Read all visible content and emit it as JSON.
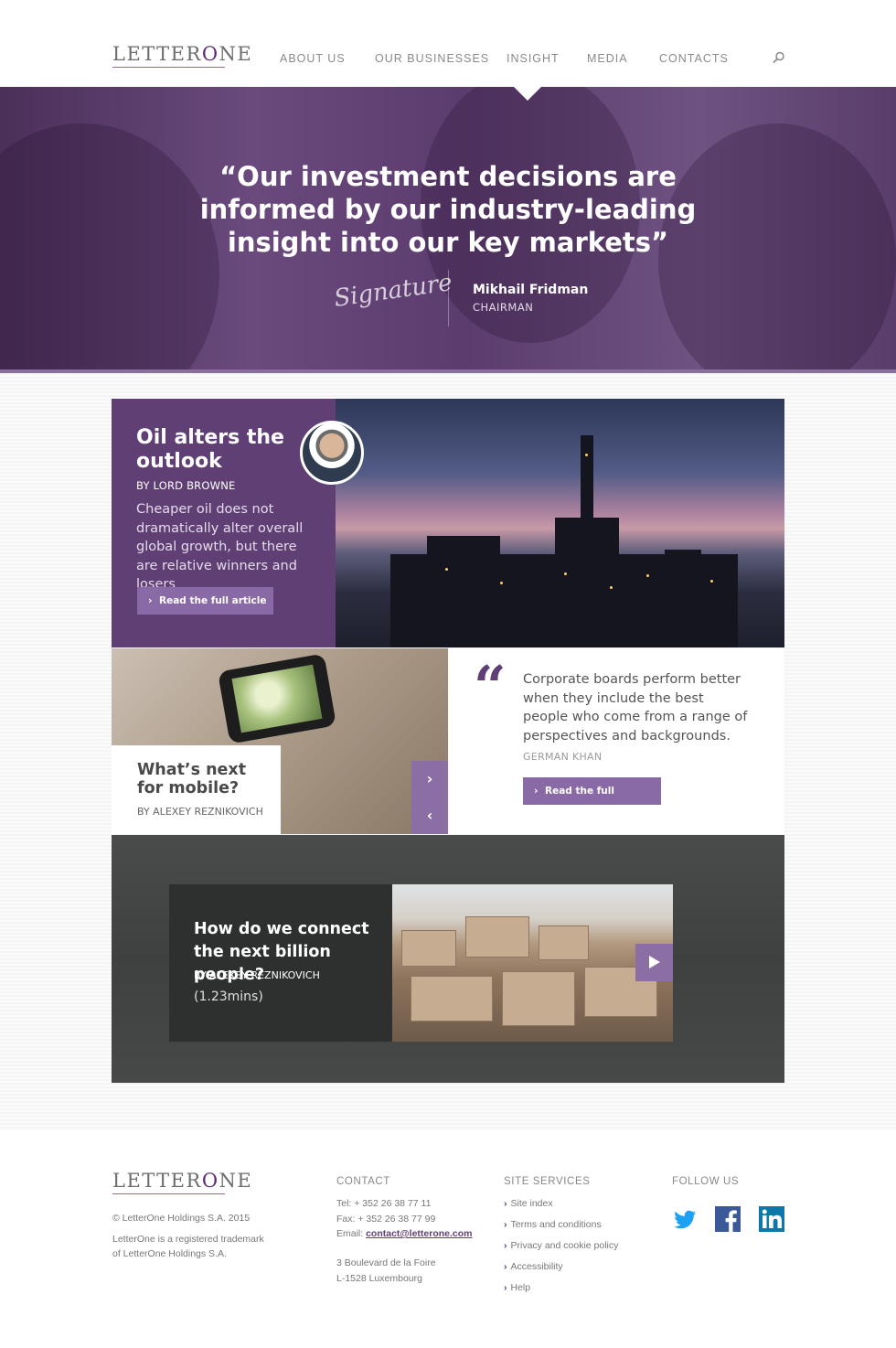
{
  "header": {
    "logo": {
      "left": "LETTER",
      "mark": "O",
      "right": "NE"
    },
    "nav": [
      "ABOUT US",
      "OUR BUSINESSES",
      "INSIGHT",
      "MEDIA",
      "CONTACTS"
    ],
    "active_nav": "INSIGHT",
    "search_icon": "search-icon"
  },
  "hero": {
    "quote": "“Our investment decisions are informed by our industry-leading insight into our key markets”",
    "signature": "Signature",
    "name": "Mikhail Fridman",
    "role": "CHAIRMAN"
  },
  "article": {
    "title": "Oil alters the outlook",
    "byline": "BY LORD BROWNE",
    "summary": "Cheaper oil does not dramatically alter overall global growth, but there are relative winners and losers",
    "button": "Read the full article"
  },
  "mobile": {
    "title": "What’s next for mobile?",
    "byline": "BY ALEXEY REZNIKOVICH",
    "next_icon": "chevron-right-icon",
    "prev_icon": "chevron-left-icon"
  },
  "quote": {
    "text": "Corporate boards perform better when they include the best people who come from a range of perspectives and backgrounds.",
    "author": "GERMAN KHAN",
    "button": "Read the full interview"
  },
  "video": {
    "title": "How do we connect the next billion people?",
    "byline": "BY ALEXEY REZNIKOVICH",
    "duration": "(1.23mins)",
    "play_icon": "play-icon"
  },
  "footer": {
    "logo": {
      "left": "LETTER",
      "mark": "O",
      "right": "NE"
    },
    "copyright": "© LetterOne Holdings S.A. 2015",
    "trademark_line1": "LetterOne is a registered trademark",
    "trademark_line2": "of LetterOne Holdings S.A.",
    "contact": {
      "heading": "CONTACT",
      "tel": "Tel: + 352 26 38 77 11",
      "fax": "Fax: + 352 26 38 77 99",
      "email_label": "Email: ",
      "email": "contact@letterone.com",
      "address1": "3 Boulevard de la Foire",
      "address2": "L-1528 Luxembourg"
    },
    "services": {
      "heading": "SITE SERVICES",
      "links": [
        "Site index",
        "Terms and conditions",
        "Privacy and cookie policy",
        "Accessibility",
        "Help"
      ]
    },
    "follow": {
      "heading": "FOLLOW US",
      "icons": [
        "twitter-icon",
        "facebook-icon",
        "linkedin-icon"
      ]
    }
  },
  "colors": {
    "brand_purple": "#5f3f74",
    "accent_purple": "#8a6aa6",
    "twitter": "#1da1f2",
    "facebook": "#3b5998",
    "linkedin": "#0e76a8"
  }
}
